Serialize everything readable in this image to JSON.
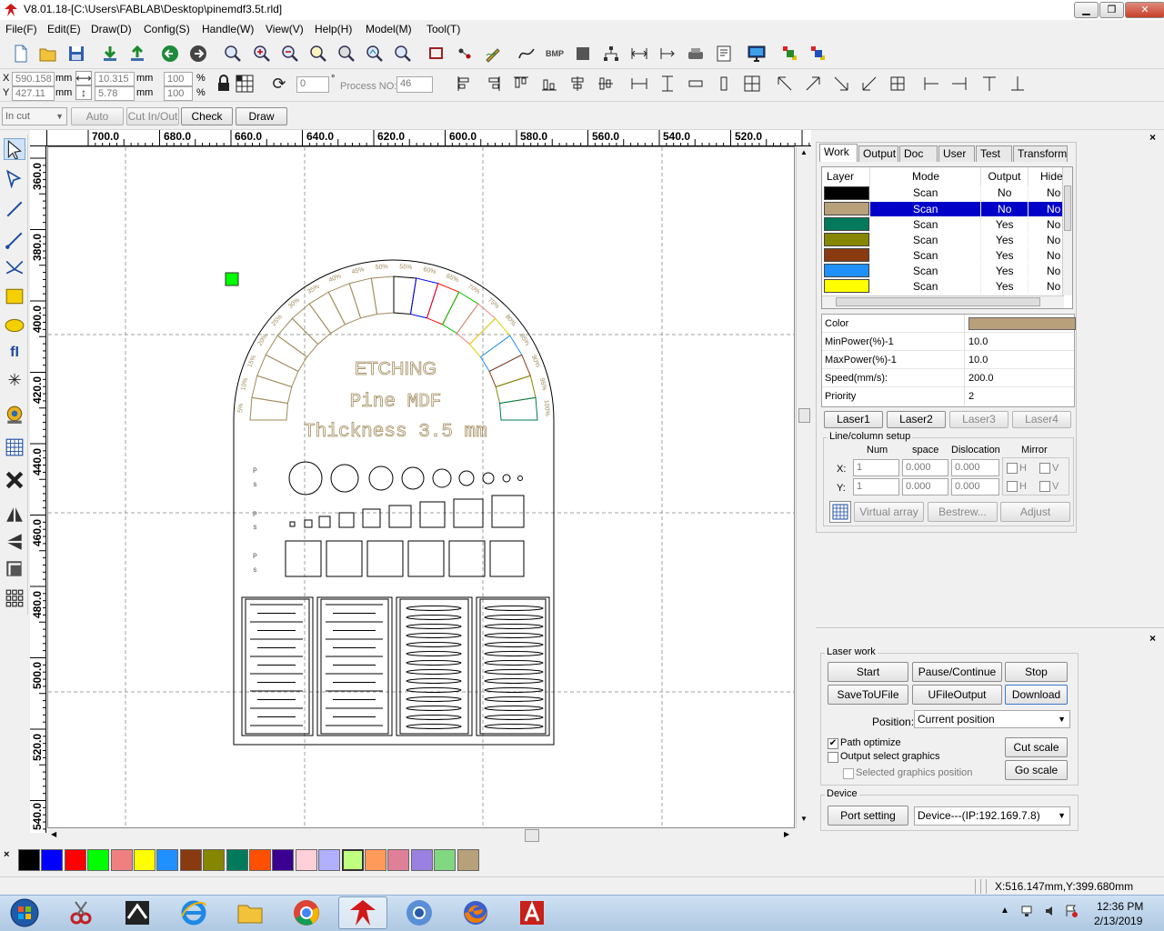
{
  "window": {
    "title": "V8.01.18-[C:\\Users\\FABLAB\\Desktop\\pinemdf3.5t.rld]",
    "controls": [
      "minimize",
      "maximize",
      "close"
    ]
  },
  "menu": [
    "File(F)",
    "Edit(E)",
    "Draw(D)",
    "Config(S)",
    "Handle(W)",
    "View(V)",
    "Help(H)",
    "Model(M)",
    "Tool(T)"
  ],
  "toolbar1_icons": [
    "new-file-icon",
    "open-folder-icon",
    "save-icon",
    "import-icon",
    "export-icon",
    "undo-icon",
    "redo-icon",
    "zoom-icon",
    "zoom-in-icon",
    "zoom-out-icon",
    "zoom-select-icon",
    "zoom-all-icon",
    "zoom-page-icon",
    "zoom-fit-icon",
    "select-rect-icon",
    "node-icon",
    "pencil-icon",
    "curve-icon",
    "bmp-icon",
    "fill-icon",
    "array-icon",
    "distance-icon",
    "center-icon",
    "laser-head-icon",
    "document-icon",
    "monitor-icon",
    "pattern-icon",
    "pattern2-icon"
  ],
  "coords": {
    "x_label": "X",
    "x_value": "590.158",
    "x_unit": "mm",
    "y_label": "Y",
    "y_value": "427.11",
    "y_unit": "mm",
    "w_value": "10.315",
    "w_unit": "mm",
    "h_value": "5.78",
    "h_unit": "mm",
    "sx_value": "100",
    "sx_unit": "%",
    "sy_value": "100",
    "sy_unit": "%",
    "rotate_value": "0",
    "rotate_unit": "°",
    "process_label": "Process NO:",
    "process_value": "46"
  },
  "toolbar3": {
    "mode_select": "In cut",
    "auto_label": "Auto",
    "cutinout_label": "Cut In/Out",
    "check_label": "Check",
    "draw_label": "Draw"
  },
  "ruler_h": [
    "700.0",
    "680.0",
    "660.0",
    "640.0",
    "620.0",
    "600.0",
    "580.0",
    "560.0",
    "540.0",
    "520.0"
  ],
  "ruler_v": [
    "360.0",
    "380.0",
    "400.0",
    "420.0",
    "440.0",
    "460.0",
    "480.0",
    "500.0",
    "520.0",
    "540.0"
  ],
  "drawing": {
    "title1": "ETCHING",
    "title2": "Pine MDF",
    "title3": "Thickness 3.5 mm",
    "arc_labels": [
      "5%",
      "10%",
      "15%",
      "20%",
      "25%",
      "30%",
      "35%",
      "40%",
      "45%",
      "50%",
      "55%",
      "60%",
      "65%",
      "70%",
      "75%",
      "80%",
      "85%",
      "90%",
      "95%",
      "100%"
    ]
  },
  "tabs": [
    "Work",
    "Output",
    "Doc",
    "User",
    "Test",
    "Transform"
  ],
  "layer_headers": [
    "Layer",
    "Mode",
    "Output",
    "Hide"
  ],
  "layers": [
    {
      "color": "#000000",
      "mode": "Scan",
      "output": "No",
      "hide": "No"
    },
    {
      "color": "#b8a07a",
      "mode": "Scan",
      "output": "No",
      "hide": "No"
    },
    {
      "color": "#007a5a",
      "mode": "Scan",
      "output": "Yes",
      "hide": "No"
    },
    {
      "color": "#868600",
      "mode": "Scan",
      "output": "Yes",
      "hide": "No"
    },
    {
      "color": "#8a3a10",
      "mode": "Scan",
      "output": "Yes",
      "hide": "No"
    },
    {
      "color": "#2090ff",
      "mode": "Scan",
      "output": "Yes",
      "hide": "No"
    },
    {
      "color": "#ffff00",
      "mode": "Scan",
      "output": "Yes",
      "hide": "No"
    }
  ],
  "props": {
    "color_label": "Color",
    "color_value": "#b8a07a",
    "minpower_label": "MinPower(%)-1",
    "minpower_value": "10.0",
    "maxpower_label": "MaxPower(%)-1",
    "maxpower_value": "10.0",
    "speed_label": "Speed(mm/s):",
    "speed_value": "200.0",
    "priority_label": "Priority",
    "priority_value": "2"
  },
  "laser_buttons": [
    "Laser1",
    "Laser2",
    "Laser3",
    "Laser4"
  ],
  "linecol": {
    "title": "Line/column setup",
    "h_num": "Num",
    "h_space": "space",
    "h_disloc": "Dislocation",
    "h_mirror": "Mirror",
    "x_label": "X:",
    "x_num": "1",
    "x_space": "0.000",
    "x_disloc": "0.000",
    "y_label": "Y:",
    "y_num": "1",
    "y_space": "0.000",
    "y_disloc": "0.000",
    "h_label": "H",
    "v_label": "V",
    "virtual_label": "Virtual array",
    "bestrew_label": "Bestrew...",
    "adjust_label": "Adjust"
  },
  "laserwork": {
    "title": "Laser work",
    "start": "Start",
    "pause": "Pause/Continue",
    "stop": "Stop",
    "savetoufile": "SaveToUFile",
    "ufileoutput": "UFileOutput",
    "download": "Download",
    "position_label": "Position:",
    "position_value": "Current position",
    "path_optimize": "Path optimize",
    "output_select": "Output select graphics",
    "selected_pos": "Selected graphics position",
    "cut_scale": "Cut scale",
    "go_scale": "Go scale"
  },
  "device": {
    "title": "Device",
    "port_setting": "Port setting",
    "device_value": "Device---(IP:192.169.7.8)"
  },
  "palette": [
    "#000000",
    "#0000ff",
    "#ff0000",
    "#00ff00",
    "#f08080",
    "#ffff00",
    "#2090ff",
    "#8a3a10",
    "#868600",
    "#007a5a",
    "#ff5000",
    "#3a0090",
    "#ffd0d8",
    "#b0b0ff",
    "#c0ff80",
    "#ff9a5a",
    "#e08098",
    "#9a80e0",
    "#80d880",
    "#b8a07a"
  ],
  "status": {
    "coords": "X:516.147mm,Y:399.680mm"
  },
  "clock": {
    "time": "12:36 PM",
    "date": "2/13/2019"
  }
}
